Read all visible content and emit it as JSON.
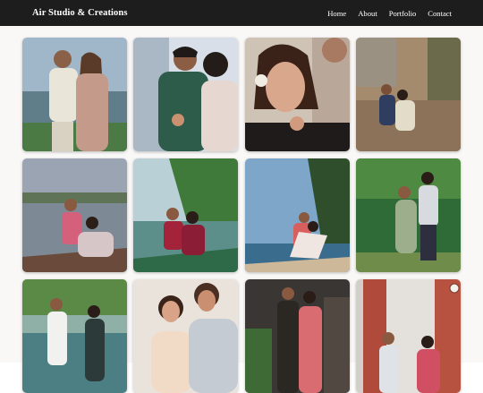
{
  "header": {
    "brand": "Air Studio & Creations",
    "nav": [
      "Home",
      "About",
      "Portfolio",
      "Contact"
    ]
  },
  "colors": {
    "header_bg": "#1d1d1d",
    "page_bg": "#f9f8f7",
    "header_text": "#ffffff"
  },
  "gallery": {
    "columns": 4,
    "visible_photo_count": 12
  }
}
